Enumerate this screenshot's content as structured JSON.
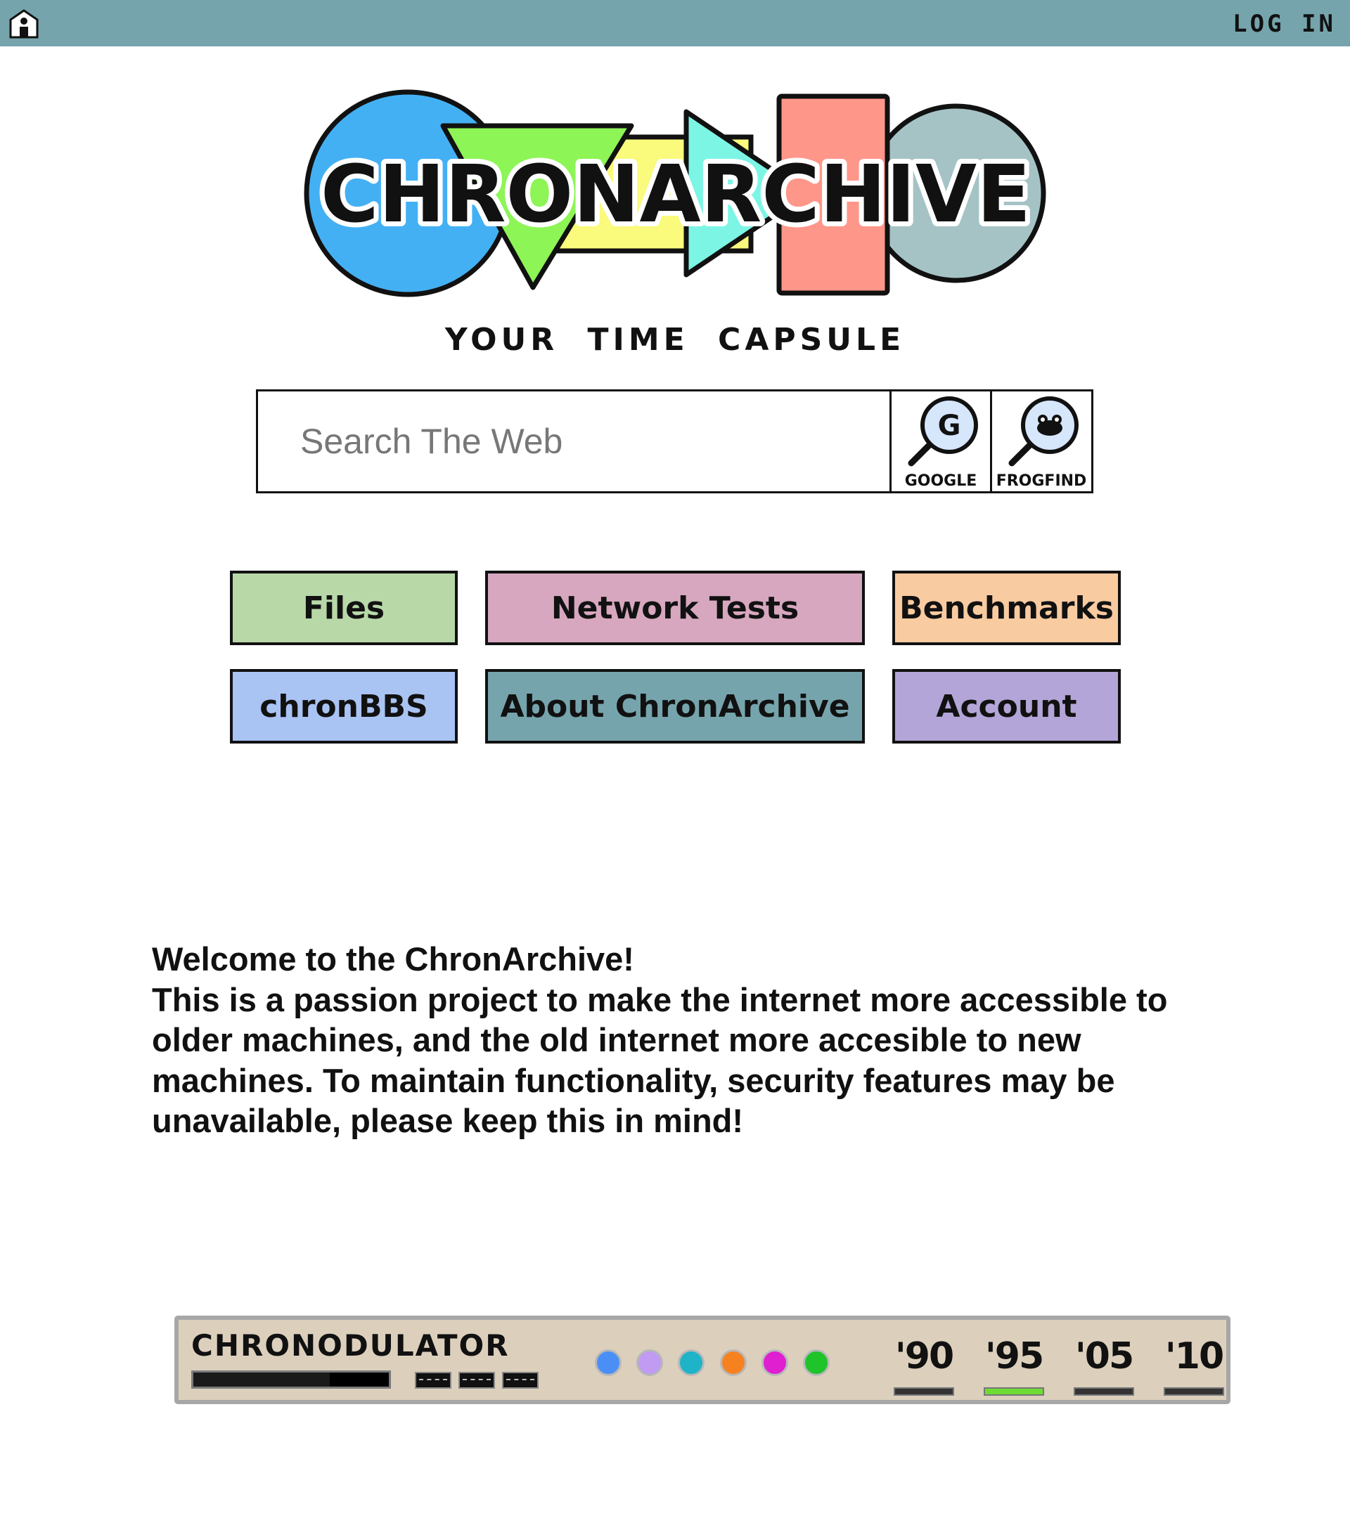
{
  "topbar": {
    "home_icon": "home-icon",
    "login_label": "LOG IN"
  },
  "logo": {
    "text": "CHRONARCHIVE",
    "colors": [
      "#44b0f4",
      "#8df556",
      "#fafa7c",
      "#7df5e5",
      "#ff968a",
      "#a5c3c5"
    ]
  },
  "tagline": "YOUR TIME CAPSULE",
  "search": {
    "placeholder": "Search The Web",
    "engines": [
      {
        "label": "GOOGLE",
        "icon": "google-magnifier-icon"
      },
      {
        "label": "FROGFIND",
        "icon": "frog-magnifier-icon"
      }
    ]
  },
  "nav": {
    "buttons": [
      {
        "label": "Files",
        "color": "#b8d8a8"
      },
      {
        "label": "Network Tests",
        "color": "#d7a7bf"
      },
      {
        "label": "Benchmarks",
        "color": "#f9cba1"
      },
      {
        "label": "chronBBS",
        "color": "#a9c3f3"
      },
      {
        "label": "About ChronArchive",
        "color": "#76a4ad"
      },
      {
        "label": "Account",
        "color": "#b3a5d7"
      }
    ]
  },
  "welcome": {
    "heading": "Welcome to the ChronArchive!",
    "body": "This is a passion project to make the internet more accessible to older machines, and the old internet more accesible to new machines. To maintain functionality, security features may be unavailable, please keep this in mind!"
  },
  "chronodulator": {
    "title": "CHRONODULATOR",
    "dots": [
      "#4a8ff5",
      "#c19af2",
      "#1fb3c7",
      "#f5821f",
      "#e01fd1",
      "#1fc32a"
    ],
    "years": [
      {
        "label": "'90",
        "active": false
      },
      {
        "label": "'95",
        "active": true
      },
      {
        "label": "'05",
        "active": false
      },
      {
        "label": "'10",
        "active": false
      }
    ],
    "active_color": "#6fdc35"
  }
}
